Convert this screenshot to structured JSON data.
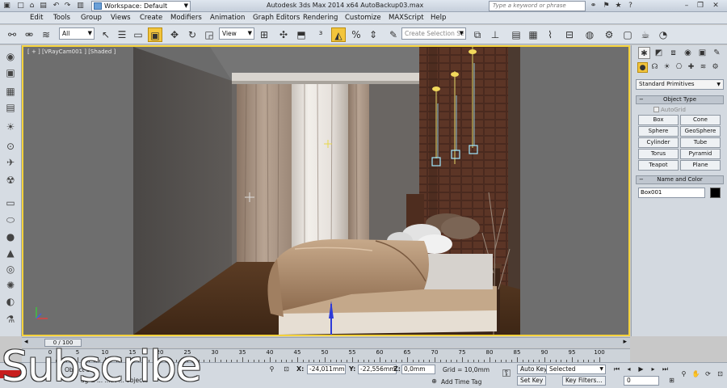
{
  "window": {
    "title": "Autodesk 3ds Max  2014 x64     AutoBackup03.max",
    "workspace": "Workspace: Default",
    "search_placeholder": "Type a keyword or phrase"
  },
  "menu": [
    "Edit",
    "Tools",
    "Group",
    "Views",
    "Create",
    "Modifiers",
    "Animation",
    "Graph Editors",
    "Rendering",
    "Customize",
    "MAXScript",
    "Help"
  ],
  "toolbar": {
    "filter_value": "All",
    "coord_system": "View",
    "selection_set_placeholder": "Create Selection Se"
  },
  "viewport": {
    "label": "[ + ] [VRayCam001 ] [Shaded ]"
  },
  "command_panel": {
    "category": "Standard Primitives",
    "object_type_title": "Object Type",
    "autogrid_label": "AutoGrid",
    "primitives": [
      "Box",
      "Cone",
      "Sphere",
      "GeoSphere",
      "Cylinder",
      "Tube",
      "Torus",
      "Pyramid",
      "Teapot",
      "Plane"
    ],
    "name_color_title": "Name and Color",
    "object_name": "Box001",
    "object_color": "#000000"
  },
  "time_slider": {
    "frame_display": "0 / 100"
  },
  "trackbar": {
    "tick_labels": [
      "0",
      "5",
      "10",
      "15",
      "20",
      "25",
      "30",
      "35",
      "40",
      "45",
      "50",
      "55",
      "60",
      "65",
      "70",
      "75",
      "80",
      "85",
      "90",
      "95",
      "100"
    ]
  },
  "status": {
    "selection_text": "Object Sel",
    "prompt_text": "ag & ... ...at ... objects",
    "x_label": "X:",
    "x_value": "-24,011mm",
    "y_label": "Y:",
    "y_value": "-22,556mm",
    "z_label": "Z:",
    "z_value": "0,0mm",
    "grid": "Grid = 10,0mm",
    "add_time_tag": "Add Time Tag",
    "auto_key": "Auto Key",
    "set_key": "Set Key",
    "key_mode": "Selected",
    "key_filters": "Key Filters...",
    "current_frame": "0"
  },
  "overlay": {
    "subscribe": "Subscribe"
  }
}
